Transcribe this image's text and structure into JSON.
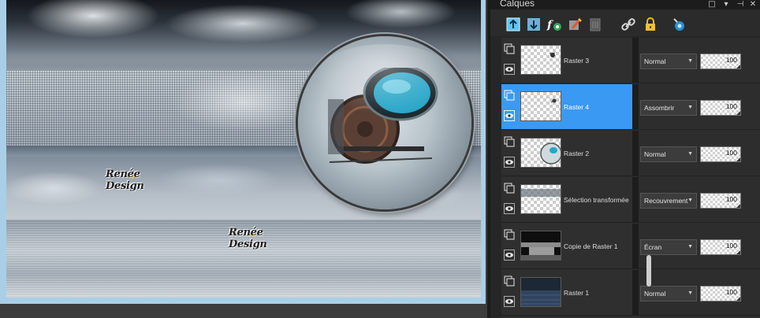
{
  "panel": {
    "title": "Calques",
    "controls": [
      "□",
      "▾",
      "⊣",
      "✕"
    ]
  },
  "toolbar": {
    "buttons": [
      "new-raster-layer-icon",
      "new-vector-layer-icon",
      "new-layer-style-icon",
      "new-mask-icon",
      "delete-layer-icon",
      "link-icon",
      "lock-icon",
      "palette-options-icon"
    ]
  },
  "watermarks": [
    "Renée Design",
    "Renée Design"
  ],
  "layers": [
    {
      "name": "Raster 3",
      "blend": "Normal",
      "opacity": "100",
      "selected": false,
      "thumb": "transparent-small-object"
    },
    {
      "name": "Raster 4",
      "blend": "Assombrir",
      "opacity": "100",
      "selected": true,
      "thumb": "transparent-small-object"
    },
    {
      "name": "Raster 2",
      "blend": "Normal",
      "opacity": "100",
      "selected": false,
      "thumb": "transparent-orb"
    },
    {
      "name": "Sélection transformée",
      "blend": "Recouvrement",
      "opacity": "100",
      "selected": false,
      "thumb": "transparent-band"
    },
    {
      "name": "Copie de Raster 1",
      "blend": "Écran",
      "opacity": "100",
      "selected": false,
      "thumb": "dark-room"
    },
    {
      "name": "Raster 1",
      "blend": "Normal",
      "opacity": "100",
      "selected": false,
      "thumb": "dark-blue-texture"
    }
  ],
  "colors": {
    "selection": "#3a99f2",
    "panel_bg": "#262626",
    "canvas_border": "#a9cfe6",
    "orb_accent": "#2aa6c8"
  }
}
